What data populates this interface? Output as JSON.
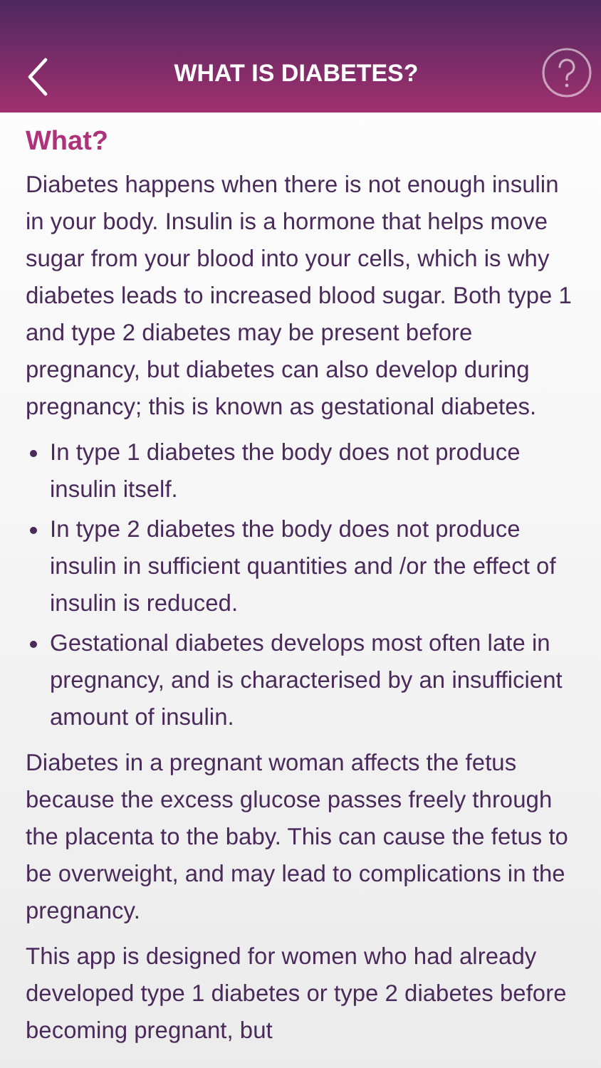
{
  "header": {
    "title": "WHAT IS DIABETES?"
  },
  "heading": "What?",
  "content": [
    {
      "kind": "paragraph",
      "text": "Diabetes happens when there is not enough insulin in your body. Insulin is a hormone that helps move sugar from your blood into your cells, which is why diabetes leads to increased blood sugar.  Both type 1 and type 2 diabetes may be present before pregnancy, but diabetes can also develop during pregnancy; this is known as gestational diabetes."
    },
    {
      "kind": "bullets",
      "items": [
        "In type 1 diabetes the body does not produce insulin itself.",
        "In type 2 diabetes the body does not produce insulin in sufficient quantities and /or the effect of insulin is reduced.",
        "Gestational diabetes develops most often late in pregnancy, and is characterised by an insufficient amount of insulin."
      ]
    },
    {
      "kind": "paragraph",
      "text": "Diabetes in a pregnant woman affects the fetus because the excess glucose passes freely through the placenta to the baby. This can cause the fetus to be overweight, and may lead to complications in the pregnancy."
    },
    {
      "kind": "paragraph",
      "text": "This app is designed for women who had already developed type 1 diabetes or type 2 diabetes before becoming pregnant, but"
    }
  ]
}
